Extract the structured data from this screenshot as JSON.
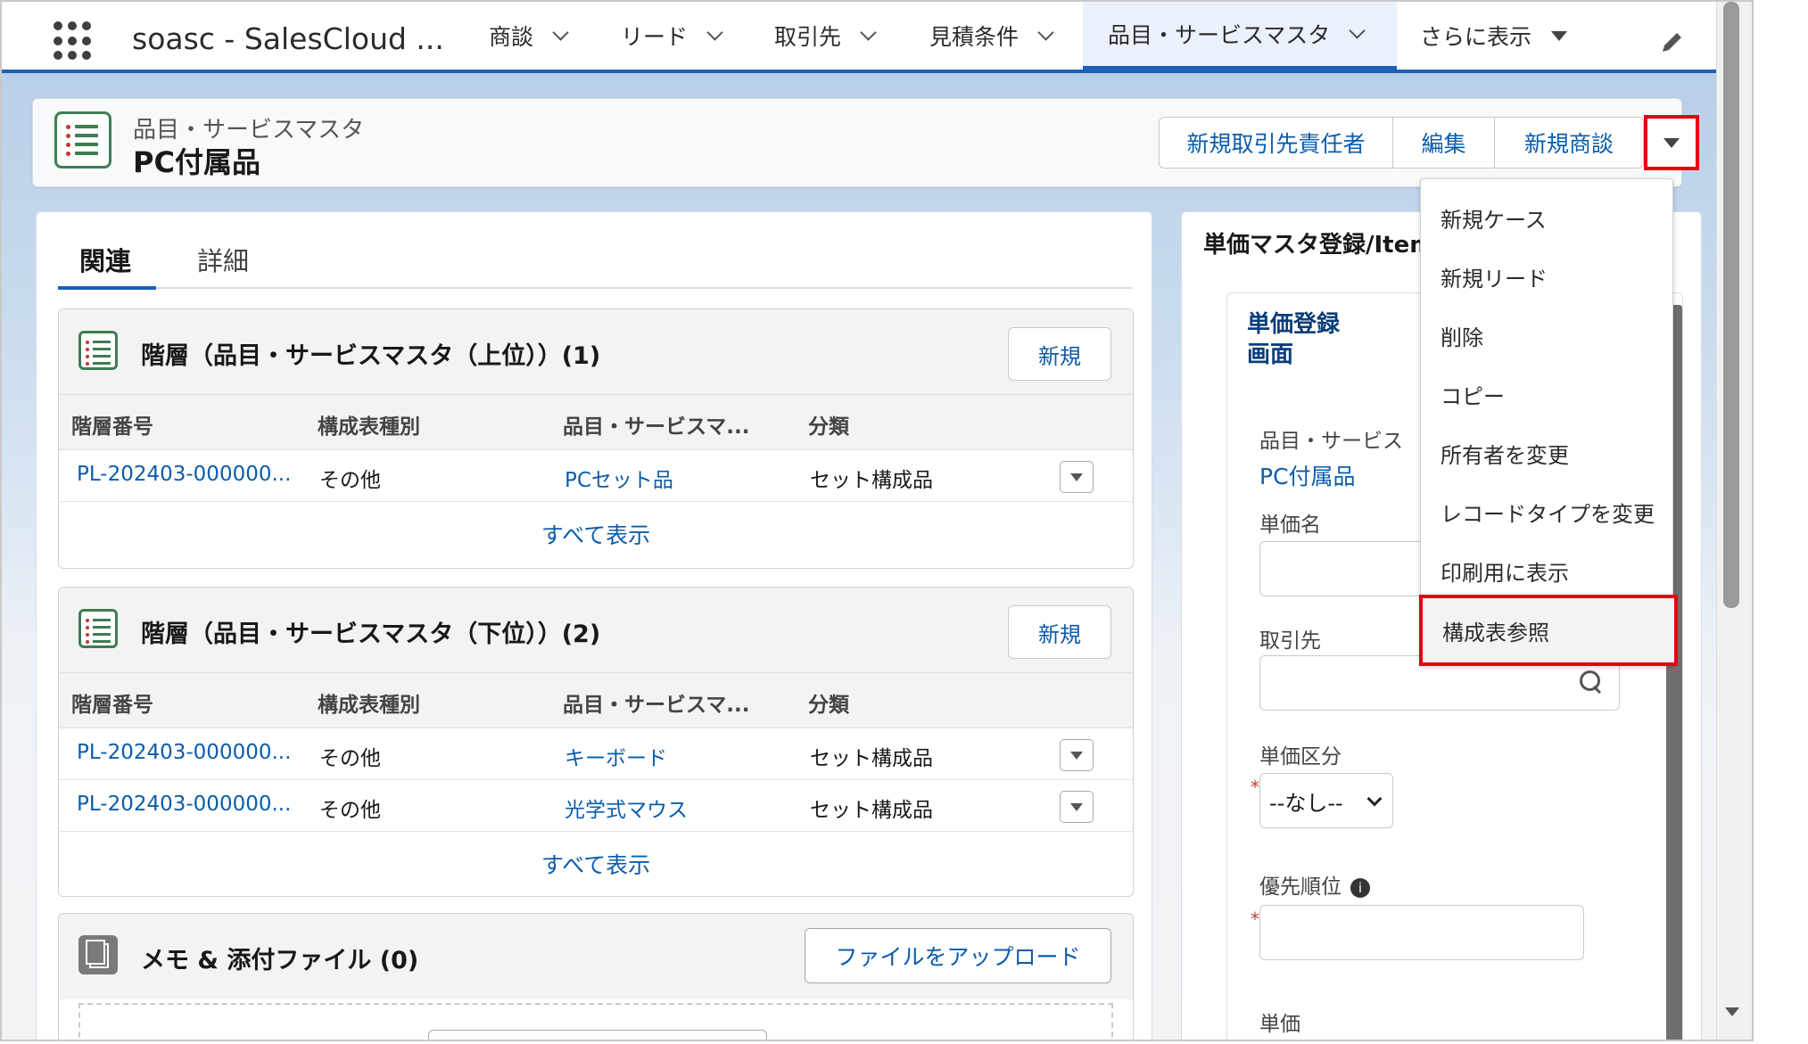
{
  "nav": {
    "app_name": "soasc - SalesCloud ...",
    "items": [
      "商談",
      "リード",
      "取引先",
      "見積条件",
      "品目・サービスマスタ"
    ],
    "more": "さらに表示"
  },
  "header": {
    "object_label": "品目・サービスマスタ",
    "record_name": "PC付属品",
    "buttons": [
      "新規取引先責任者",
      "編集",
      "新規商談"
    ]
  },
  "tabs": [
    "関連",
    "詳細"
  ],
  "related_upper": {
    "title": "階層（品目・サービスマスタ（上位））(1)",
    "new_label": "新規",
    "columns": [
      "階層番号",
      "構成表種別",
      "品目・サービスマ...",
      "分類"
    ],
    "rows": [
      [
        "PL-202403-000000...",
        "その他",
        "PCセット品",
        "セット構成品"
      ]
    ],
    "view_all": "すべて表示"
  },
  "related_lower": {
    "title": "階層（品目・サービスマスタ（下位））(2)",
    "new_label": "新規",
    "columns": [
      "階層番号",
      "構成表種別",
      "品目・サービスマ...",
      "分類"
    ],
    "rows": [
      [
        "PL-202403-000000...",
        "その他",
        "キーボード",
        "セット構成品"
      ],
      [
        "PL-202403-000000...",
        "その他",
        "光学式マウス",
        "セット構成品"
      ]
    ],
    "view_all": "すべて表示"
  },
  "notes": {
    "title": "メモ & 添付ファイル (0)",
    "upload_label": "ファイルをアップロード"
  },
  "right_panel": {
    "title": "単価マスタ登録/Item",
    "form_title_1": "単価登録",
    "form_title_2": "画面",
    "item_label": "品目・サービス",
    "item_value": "PC付属品",
    "price_name_label": "単価名",
    "account_label": "取引先",
    "price_type_label": "単価区分",
    "price_type_value": "--なし--",
    "priority_label": "優先順位",
    "price_label": "単価",
    "required_mark": "*",
    "info_mark": "i"
  },
  "menu": {
    "items": [
      "新規ケース",
      "新規リード",
      "削除",
      "コピー",
      "所有者を変更",
      "レコードタイプを変更",
      "印刷用に表示",
      "構成表参照"
    ]
  },
  "colors": {
    "brand": "#1b5fb8",
    "link": "#0b5cab",
    "highlight": "#e60012",
    "icon_green": "#3d7d52"
  }
}
